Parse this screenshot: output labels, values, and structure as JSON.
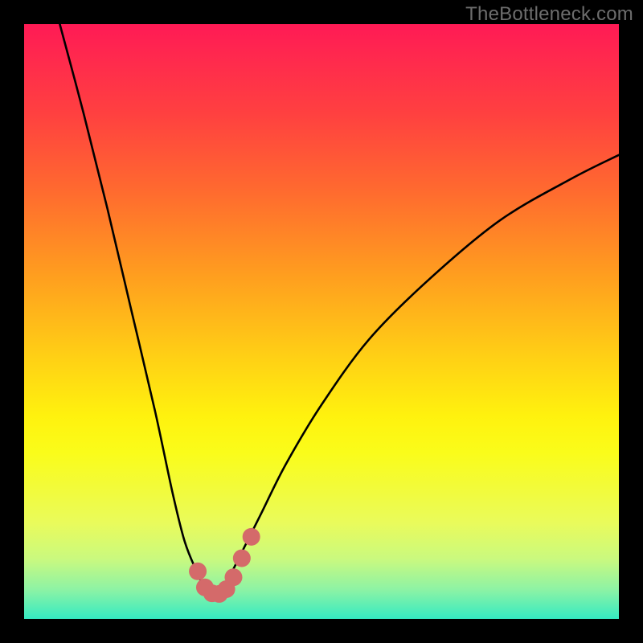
{
  "watermark": "TheBottleneck.com",
  "chart_data": {
    "type": "line",
    "title": "",
    "xlabel": "",
    "ylabel": "",
    "xlim": [
      0,
      100
    ],
    "ylim": [
      0,
      100
    ],
    "series": [
      {
        "name": "bottleneck-curve",
        "x": [
          6,
          10,
          14,
          18,
          22,
          25,
          27,
          29,
          30.5,
          31.5,
          32.5,
          33.5,
          35,
          37,
          40,
          44,
          50,
          58,
          68,
          80,
          92,
          100
        ],
        "values": [
          100,
          85,
          69,
          52,
          35,
          21,
          13,
          8,
          5,
          4,
          4,
          5,
          8,
          12,
          18,
          26,
          36,
          47,
          57,
          67,
          74,
          78
        ]
      }
    ],
    "markers": {
      "name": "highlight-points",
      "color": "#d46a6a",
      "x": [
        29.2,
        30.4,
        31.6,
        32.8,
        34.0,
        35.2,
        36.6,
        38.2
      ],
      "values": [
        8.0,
        5.3,
        4.3,
        4.2,
        5.0,
        7.0,
        10.2,
        13.8
      ]
    },
    "gradient_stops": [
      {
        "pct": 0,
        "color": "#ff1a55"
      },
      {
        "pct": 6,
        "color": "#ff2a4d"
      },
      {
        "pct": 15,
        "color": "#ff4040"
      },
      {
        "pct": 28,
        "color": "#ff6a2f"
      },
      {
        "pct": 42,
        "color": "#ff9d1f"
      },
      {
        "pct": 56,
        "color": "#ffd015"
      },
      {
        "pct": 66,
        "color": "#fff20e"
      },
      {
        "pct": 72,
        "color": "#fafc1a"
      },
      {
        "pct": 78,
        "color": "#f2fb3a"
      },
      {
        "pct": 84,
        "color": "#e9fb5c"
      },
      {
        "pct": 90,
        "color": "#c9f97f"
      },
      {
        "pct": 95,
        "color": "#8ef3a4"
      },
      {
        "pct": 100,
        "color": "#35eac2"
      }
    ]
  }
}
